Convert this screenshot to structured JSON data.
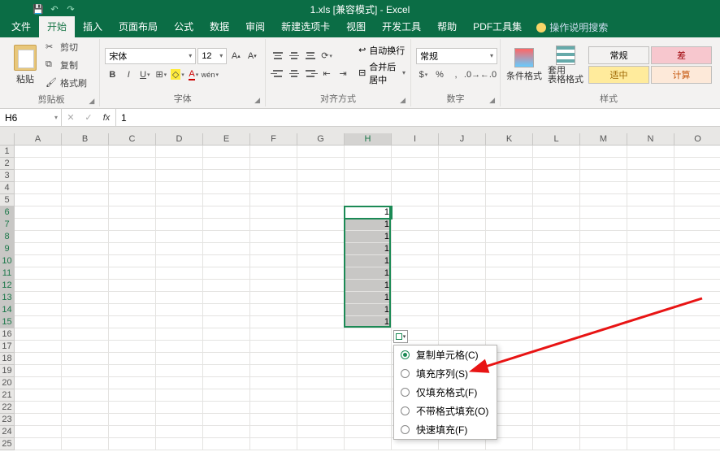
{
  "title": "1.xls [兼容模式] - Excel",
  "tabs": [
    "文件",
    "开始",
    "插入",
    "页面布局",
    "公式",
    "数据",
    "审阅",
    "新建选项卡",
    "视图",
    "开发工具",
    "帮助",
    "PDF工具集"
  ],
  "active_tab": 1,
  "tell_me": "操作说明搜索",
  "clipboard": {
    "paste": "粘贴",
    "cut": "剪切",
    "copy": "复制",
    "painter": "格式刷",
    "label": "剪贴板"
  },
  "font": {
    "name": "宋体",
    "size": "12",
    "label": "字体",
    "bold": "B",
    "italic": "I",
    "underline": "U"
  },
  "alignment": {
    "wrap": "自动换行",
    "merge": "合并后居中",
    "label": "对齐方式"
  },
  "number": {
    "format": "常规",
    "label": "数字"
  },
  "styles": {
    "cond": "条件格式",
    "table": "套用\n表格格式",
    "normal": "常规",
    "bad": "差",
    "neutral": "适中",
    "calc": "计算",
    "label": "样式"
  },
  "namebox": "H6",
  "formula": "1",
  "columns": [
    "A",
    "B",
    "C",
    "D",
    "E",
    "F",
    "G",
    "H",
    "I",
    "J",
    "K",
    "L",
    "M",
    "N",
    "O"
  ],
  "active_col_index": 7,
  "fill_values": [
    "1",
    "1",
    "1",
    "1",
    "1",
    "1",
    "1",
    "1",
    "1",
    "1"
  ],
  "fill_start_row": 6,
  "fill_end_row": 15,
  "autofill_menu": {
    "items": [
      {
        "label": "复制单元格(C)",
        "sel": true
      },
      {
        "label": "填充序列(S)",
        "sel": false
      },
      {
        "label": "仅填充格式(F)",
        "sel": false
      },
      {
        "label": "不带格式填充(O)",
        "sel": false
      },
      {
        "label": "快速填充(F)",
        "sel": false
      }
    ]
  }
}
